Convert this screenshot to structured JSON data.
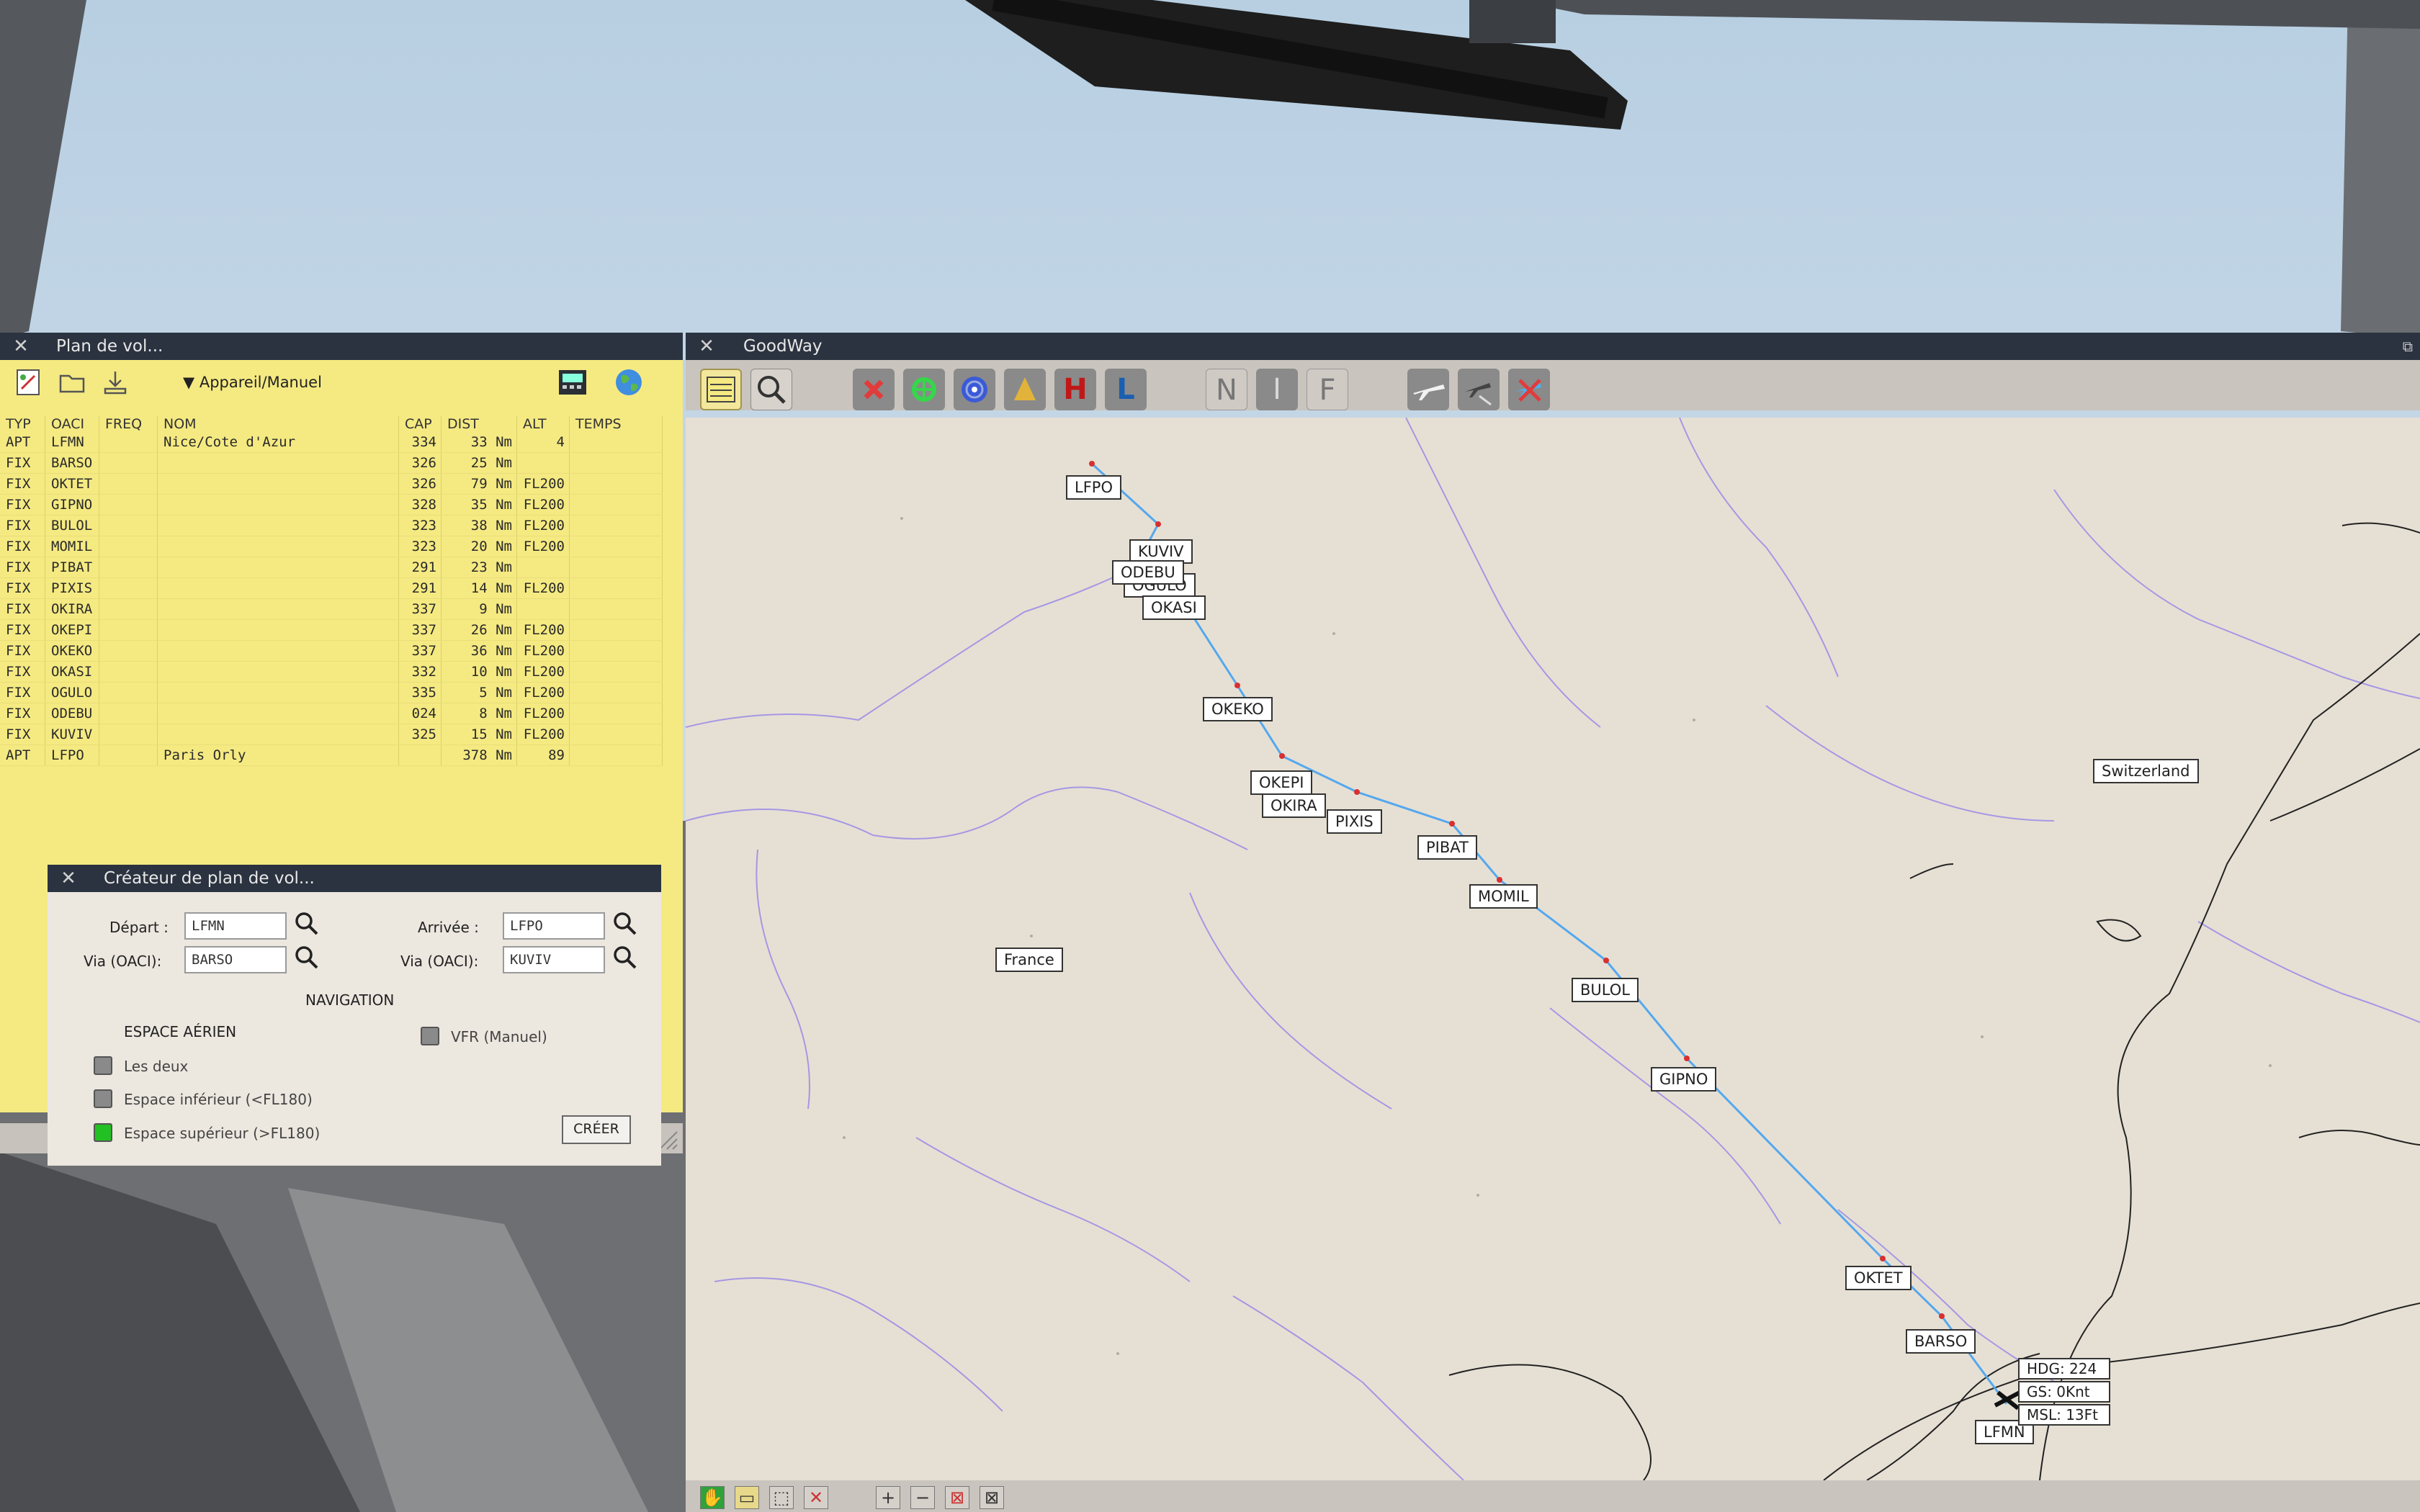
{
  "flight_plan_window": {
    "title": "Plan de vol...",
    "aircraft_menu": "Appareil/Manuel",
    "columns": [
      "TYP",
      "OACI",
      "FREQ",
      "NOM",
      "CAP",
      "DIST",
      "ALT",
      "TEMPS"
    ],
    "rows": [
      {
        "typ": "APT",
        "oaci": "LFMN",
        "freq": "",
        "nom": "Nice/Cote d'Azur",
        "cap": "334",
        "dist": "33 Nm",
        "alt": "4",
        "temps": ""
      },
      {
        "typ": "FIX",
        "oaci": "BARSO",
        "freq": "",
        "nom": "",
        "cap": "326",
        "dist": "25 Nm",
        "alt": "",
        "temps": ""
      },
      {
        "typ": "FIX",
        "oaci": "OKTET",
        "freq": "",
        "nom": "",
        "cap": "326",
        "dist": "79 Nm",
        "alt": "FL200",
        "temps": ""
      },
      {
        "typ": "FIX",
        "oaci": "GIPNO",
        "freq": "",
        "nom": "",
        "cap": "328",
        "dist": "35 Nm",
        "alt": "FL200",
        "temps": ""
      },
      {
        "typ": "FIX",
        "oaci": "BULOL",
        "freq": "",
        "nom": "",
        "cap": "323",
        "dist": "38 Nm",
        "alt": "FL200",
        "temps": ""
      },
      {
        "typ": "FIX",
        "oaci": "MOMIL",
        "freq": "",
        "nom": "",
        "cap": "323",
        "dist": "20 Nm",
        "alt": "FL200",
        "temps": ""
      },
      {
        "typ": "FIX",
        "oaci": "PIBAT",
        "freq": "",
        "nom": "",
        "cap": "291",
        "dist": "23 Nm",
        "alt": "",
        "temps": ""
      },
      {
        "typ": "FIX",
        "oaci": "PIXIS",
        "freq": "",
        "nom": "",
        "cap": "291",
        "dist": "14 Nm",
        "alt": "FL200",
        "temps": ""
      },
      {
        "typ": "FIX",
        "oaci": "OKIRA",
        "freq": "",
        "nom": "",
        "cap": "337",
        "dist": "9 Nm",
        "alt": "",
        "temps": ""
      },
      {
        "typ": "FIX",
        "oaci": "OKEPI",
        "freq": "",
        "nom": "",
        "cap": "337",
        "dist": "26 Nm",
        "alt": "FL200",
        "temps": ""
      },
      {
        "typ": "FIX",
        "oaci": "OKEKO",
        "freq": "",
        "nom": "",
        "cap": "337",
        "dist": "36 Nm",
        "alt": "FL200",
        "temps": ""
      },
      {
        "typ": "FIX",
        "oaci": "OKASI",
        "freq": "",
        "nom": "",
        "cap": "332",
        "dist": "10 Nm",
        "alt": "FL200",
        "temps": ""
      },
      {
        "typ": "FIX",
        "oaci": "OGULO",
        "freq": "",
        "nom": "",
        "cap": "335",
        "dist": "5 Nm",
        "alt": "FL200",
        "temps": ""
      },
      {
        "typ": "FIX",
        "oaci": "ODEBU",
        "freq": "",
        "nom": "",
        "cap": "024",
        "dist": "8 Nm",
        "alt": "FL200",
        "temps": ""
      },
      {
        "typ": "FIX",
        "oaci": "KUVIV",
        "freq": "",
        "nom": "",
        "cap": "325",
        "dist": "15 Nm",
        "alt": "FL200",
        "temps": ""
      },
      {
        "typ": "APT",
        "oaci": "LFPO",
        "freq": "",
        "nom": "Paris Orly",
        "cap": "",
        "dist": "378 Nm",
        "alt": "89",
        "temps": ""
      }
    ]
  },
  "creator_window": {
    "title": "Créateur de plan de vol...",
    "depart_label": "Départ :",
    "depart_value": "LFMN",
    "arrivee_label": "Arrivée :",
    "arrivee_value": "LFPO",
    "via_label_1": "Via (OACI):",
    "via_value_1": "BARSO",
    "via_label_2": "Via (OACI):",
    "via_value_2": "KUVIV",
    "navigation_heading": "NAVIGATION",
    "airspace_heading": "ESPACE AÉRIEN",
    "vfr_label": "VFR (Manuel)",
    "opt_both": "Les deux",
    "opt_lower": "Espace inférieur (<FL180)",
    "opt_upper": "Espace supérieur (>FL180)",
    "create_button": "CRÉER",
    "colors": {
      "checked": "#22c022",
      "unchecked": "#8a8a8a"
    }
  },
  "goodway_window": {
    "title": "GoodWay",
    "toolbar": {
      "h_label": "H",
      "l_label": "L",
      "n_label": "N",
      "i_label": "I",
      "f_label": "F"
    },
    "map": {
      "country_france": "France",
      "country_switzerland": "Switzerland",
      "waypoints": [
        "LFPO",
        "KUVIV",
        "ODEBU",
        "OGULO",
        "OKASI",
        "OKEKO",
        "OKEPI",
        "OKIRA",
        "PIXIS",
        "PIBAT",
        "MOMIL",
        "BULOL",
        "GIPNO",
        "OKTET",
        "BARSO",
        "LFMN"
      ],
      "info": {
        "hdg": "HDG: 224",
        "gs": "GS: 0Knt",
        "msl": "MSL: 13Ft"
      },
      "route_color": "#55a8ee"
    }
  }
}
